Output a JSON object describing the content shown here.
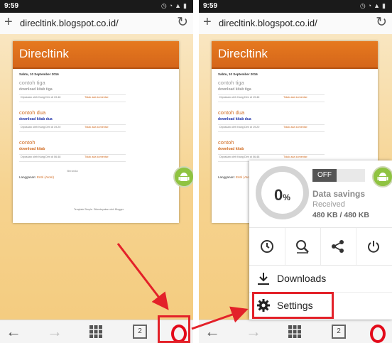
{
  "status": {
    "time": "9:59"
  },
  "browser": {
    "url": "direcltink.blogspot.co.id/",
    "tab_count": "2"
  },
  "blog": {
    "title": "Direcltink",
    "date_header": "Sabtu, 10 September 2016",
    "posts": [
      {
        "title": "contoh tiga",
        "link": "download kitab tiga",
        "posted_by": "Diposkan oleh Kang Dim di 19.46",
        "comments": "Tidak ada komentar:"
      },
      {
        "title": "contoh dua",
        "link": "download kitab dua",
        "posted_by": "Diposkan oleh Kang Dim di 19.20",
        "comments": "Tidak ada komentar:"
      },
      {
        "title": "contoh",
        "link": "download kitab",
        "posted_by": "Diposkan oleh Kang Dim di 06.48",
        "comments": "Tidak ada komentar:"
      }
    ],
    "home_link": "Beranda",
    "subscribe_label": "Langganan:",
    "subscribe_link": "Entri (Atom)",
    "template_credit": "Template Simple. Diberdayakan oleh Blogger."
  },
  "data_savings": {
    "toggle_label": "OFF",
    "percent": "0",
    "percent_sign": "%",
    "title": "Data savings",
    "received_label": "Received",
    "amount": "480 KB / 480 KB"
  },
  "menu": {
    "quick_actions": [
      "history-icon",
      "find-in-page-icon",
      "share-icon",
      "power-icon"
    ],
    "downloads_label": "Downloads",
    "settings_label": "Settings"
  },
  "colors": {
    "accent_red": "#e32129",
    "opera_red": "#e30a1a",
    "blog_header": "#e6791f",
    "android_green": "#8fc341",
    "link_orange": "#d0691e",
    "link_blue": "#1d2fa8"
  }
}
